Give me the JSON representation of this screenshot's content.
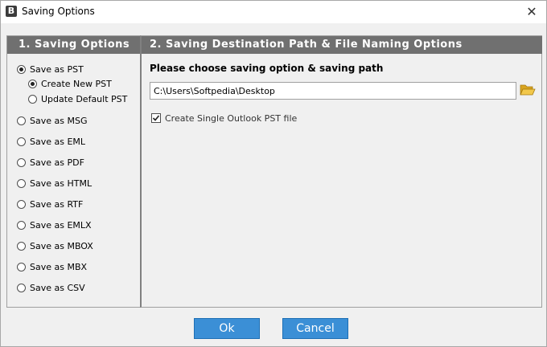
{
  "window": {
    "title": "Saving Options",
    "app_icon_letter": "B",
    "close_glyph": "✕"
  },
  "left_panel": {
    "header": "1. Saving Options",
    "options": [
      {
        "label": "Save as PST",
        "checked": true
      },
      {
        "label": "Save as MSG",
        "checked": false
      },
      {
        "label": "Save as EML",
        "checked": false
      },
      {
        "label": "Save as PDF",
        "checked": false
      },
      {
        "label": "Save as HTML",
        "checked": false
      },
      {
        "label": "Save as RTF",
        "checked": false
      },
      {
        "label": "Save as EMLX",
        "checked": false
      },
      {
        "label": "Save as MBOX",
        "checked": false
      },
      {
        "label": "Save as MBX",
        "checked": false
      },
      {
        "label": "Save as CSV",
        "checked": false
      }
    ],
    "pst_suboptions": [
      {
        "label": "Create New PST",
        "checked": true
      },
      {
        "label": "Update Default PST",
        "checked": false
      }
    ]
  },
  "right_panel": {
    "header": "2. Saving Destination Path & File Naming Options",
    "section_title": "Please choose saving option & saving path",
    "path_value": "C:\\Users\\Softpedia\\Desktop",
    "folder_icon": "folder-open-icon",
    "create_single_pst_label": "Create Single Outlook PST file",
    "create_single_pst_checked": true
  },
  "buttons": {
    "ok": "Ok",
    "cancel": "Cancel"
  },
  "colors": {
    "header_bg": "#707070",
    "button_bg": "#3b8fd6",
    "folder_yellow": "#e8b93a"
  }
}
